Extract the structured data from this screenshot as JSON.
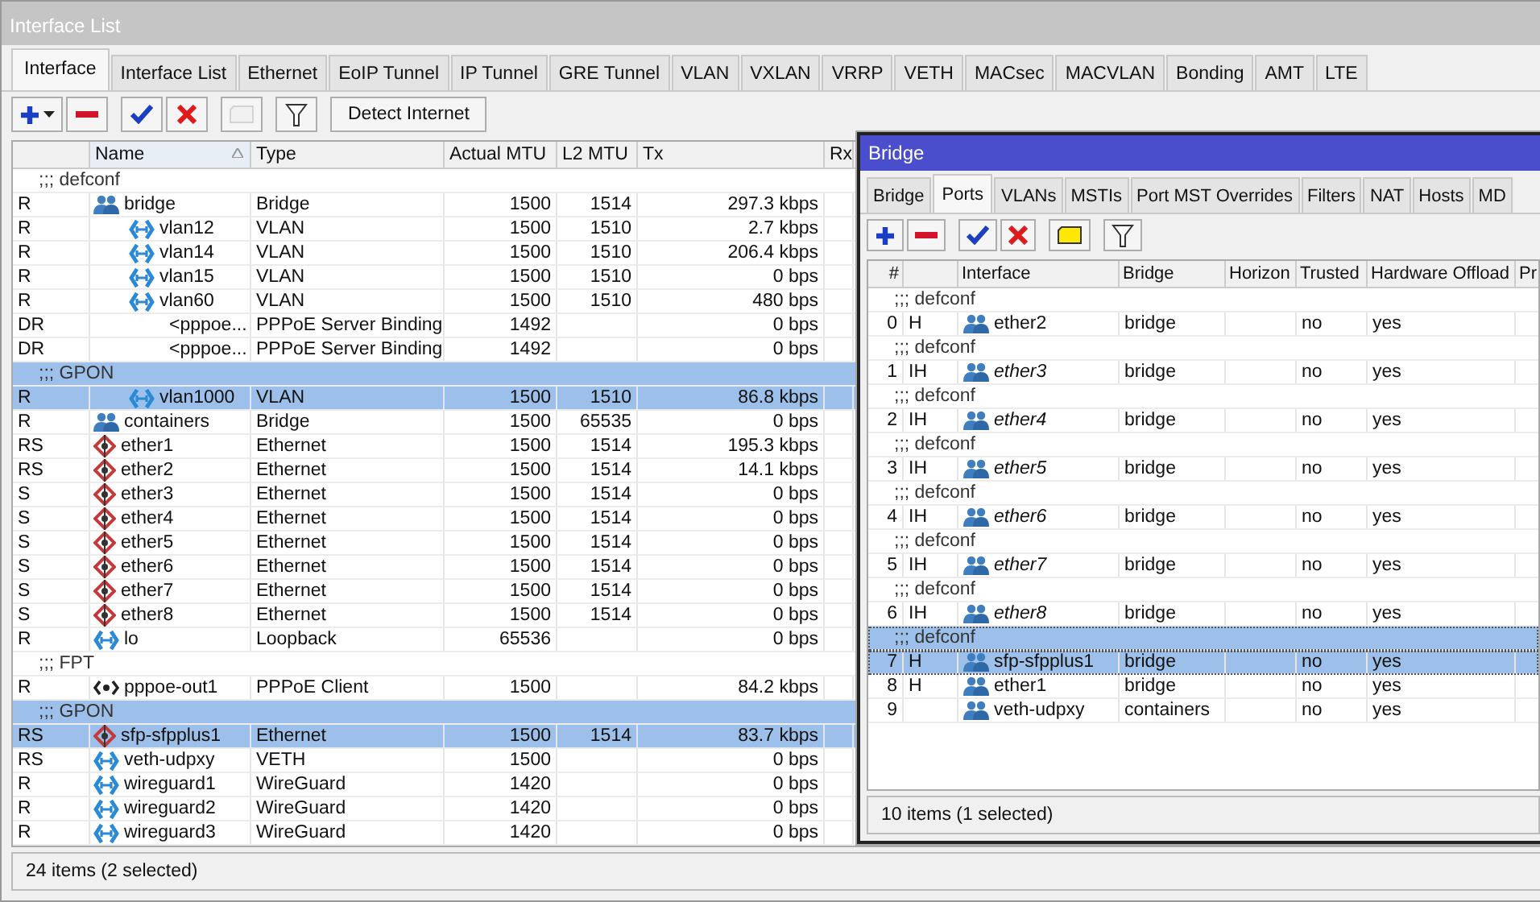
{
  "interface_window": {
    "title": "Interface List",
    "tabs": [
      {
        "label": "Interface",
        "selected": true
      },
      {
        "label": "Interface List",
        "selected": false
      },
      {
        "label": "Ethernet",
        "selected": false
      },
      {
        "label": "EoIP Tunnel",
        "selected": false
      },
      {
        "label": "IP Tunnel",
        "selected": false
      },
      {
        "label": "GRE Tunnel",
        "selected": false
      },
      {
        "label": "VLAN",
        "selected": false
      },
      {
        "label": "VXLAN",
        "selected": false
      },
      {
        "label": "VRRP",
        "selected": false
      },
      {
        "label": "VETH",
        "selected": false
      },
      {
        "label": "MACsec",
        "selected": false
      },
      {
        "label": "MACVLAN",
        "selected": false
      },
      {
        "label": "Bonding",
        "selected": false
      },
      {
        "label": "AMT",
        "selected": false
      },
      {
        "label": "LTE",
        "selected": false
      }
    ],
    "toolbar": [
      {
        "kind": "add",
        "disabled": false
      },
      {
        "kind": "remove",
        "disabled": false
      },
      {
        "kind": "enable",
        "disabled": false
      },
      {
        "kind": "disable",
        "disabled": false
      },
      {
        "kind": "comment",
        "disabled": true
      },
      {
        "kind": "filter",
        "disabled": false
      }
    ],
    "detect_button": "Detect Internet",
    "columns": [
      {
        "label": "Name",
        "sorted": true
      },
      {
        "label": "Type",
        "sorted": false
      },
      {
        "label": "Actual MTU",
        "sorted": false
      },
      {
        "label": "L2 MTU",
        "sorted": false
      },
      {
        "label": "Tx",
        "sorted": false
      },
      {
        "label": "Rx",
        "sorted": false
      }
    ],
    "rows": [
      {
        "comment": ";;; defconf",
        "flags": "R",
        "name": "bridge",
        "kind": "bridge",
        "type": "Bridge",
        "mtu": "1500",
        "l2mtu": "1514",
        "tx": "297.3 kbps",
        "selected": false,
        "children": [
          {
            "flags": "R",
            "name": "vlan12",
            "kind": "vlan",
            "type": "VLAN",
            "mtu": "1500",
            "l2mtu": "1510",
            "tx": "2.7 kbps",
            "selected": false
          },
          {
            "flags": "R",
            "name": "vlan14",
            "kind": "vlan",
            "type": "VLAN",
            "mtu": "1500",
            "l2mtu": "1510",
            "tx": "206.4 kbps",
            "selected": false
          },
          {
            "flags": "R",
            "name": "vlan15",
            "kind": "vlan",
            "type": "VLAN",
            "mtu": "1500",
            "l2mtu": "1510",
            "tx": "0 bps",
            "selected": false
          },
          {
            "flags": "R",
            "name": "vlan60",
            "kind": "vlan",
            "type": "VLAN",
            "mtu": "1500",
            "l2mtu": "1510",
            "tx": "480 bps",
            "selected": false,
            "children": [
              {
                "flags": "DR",
                "name": "<pppoe...",
                "kind": "pppoe",
                "type": "PPPoE Server Binding",
                "mtu": "1492",
                "tx": "0 bps",
                "selected": false
              },
              {
                "flags": "DR",
                "name": "<pppoe...",
                "kind": "pppoe",
                "type": "PPPoE Server Binding",
                "mtu": "1492",
                "tx": "0 bps",
                "selected": false
              }
            ]
          },
          {
            "comment": ";;; GPON",
            "flags": "R",
            "name": "vlan1000",
            "kind": "vlan",
            "type": "VLAN",
            "mtu": "1500",
            "l2mtu": "1510",
            "tx": "86.8 kbps",
            "selected": true
          }
        ]
      },
      {
        "flags": "R",
        "name": "containers",
        "kind": "bridge",
        "type": "Bridge",
        "mtu": "1500",
        "l2mtu": "65535",
        "tx": "0 bps",
        "selected": false
      },
      {
        "flags": "RS",
        "name": "ether1",
        "kind": "ether",
        "type": "Ethernet",
        "mtu": "1500",
        "l2mtu": "1514",
        "tx": "195.3 kbps",
        "selected": false
      },
      {
        "flags": "RS",
        "name": "ether2",
        "kind": "ether",
        "type": "Ethernet",
        "mtu": "1500",
        "l2mtu": "1514",
        "tx": "14.1 kbps",
        "selected": false
      },
      {
        "flags": "S",
        "name": "ether3",
        "kind": "ether",
        "type": "Ethernet",
        "mtu": "1500",
        "l2mtu": "1514",
        "tx": "0 bps",
        "selected": false
      },
      {
        "flags": "S",
        "name": "ether4",
        "kind": "ether",
        "type": "Ethernet",
        "mtu": "1500",
        "l2mtu": "1514",
        "tx": "0 bps",
        "selected": false
      },
      {
        "flags": "S",
        "name": "ether5",
        "kind": "ether",
        "type": "Ethernet",
        "mtu": "1500",
        "l2mtu": "1514",
        "tx": "0 bps",
        "selected": false
      },
      {
        "flags": "S",
        "name": "ether6",
        "kind": "ether",
        "type": "Ethernet",
        "mtu": "1500",
        "l2mtu": "1514",
        "tx": "0 bps",
        "selected": false
      },
      {
        "flags": "S",
        "name": "ether7",
        "kind": "ether",
        "type": "Ethernet",
        "mtu": "1500",
        "l2mtu": "1514",
        "tx": "0 bps",
        "selected": false
      },
      {
        "flags": "S",
        "name": "ether8",
        "kind": "ether",
        "type": "Ethernet",
        "mtu": "1500",
        "l2mtu": "1514",
        "tx": "0 bps",
        "selected": false
      },
      {
        "flags": "R",
        "name": "lo",
        "kind": "loopback",
        "type": "Loopback",
        "mtu": "65536",
        "tx": "0 bps",
        "selected": false
      },
      {
        "comment": ";;; FPT",
        "flags": "R",
        "name": "pppoe-out1",
        "kind": "pppoe",
        "type": "PPPoE Client",
        "mtu": "1500",
        "tx": "84.2 kbps",
        "selected": false
      },
      {
        "comment": ";;; GPON",
        "flags": "RS",
        "name": "sfp-sfpplus1",
        "kind": "ether",
        "type": "Ethernet",
        "mtu": "1500",
        "l2mtu": "1514",
        "tx": "83.7 kbps",
        "selected": true
      },
      {
        "flags": "RS",
        "name": "veth-udpxy",
        "kind": "veth",
        "type": "VETH",
        "mtu": "1500",
        "tx": "0 bps",
        "selected": false
      },
      {
        "flags": "R",
        "name": "wireguard1",
        "kind": "wireguard",
        "type": "WireGuard",
        "mtu": "1420",
        "tx": "0 bps",
        "selected": false
      },
      {
        "flags": "R",
        "name": "wireguard2",
        "kind": "wireguard",
        "type": "WireGuard",
        "mtu": "1420",
        "tx": "0 bps",
        "selected": false
      },
      {
        "flags": "R",
        "name": "wireguard3",
        "kind": "wireguard",
        "type": "WireGuard",
        "mtu": "1420",
        "tx": "0 bps",
        "selected": false
      }
    ],
    "status": "24 items (2 selected)"
  },
  "bridge_window": {
    "title": "Bridge",
    "tabs": [
      {
        "label": "Bridge",
        "selected": false
      },
      {
        "label": "Ports",
        "selected": true
      },
      {
        "label": "VLANs",
        "selected": false
      },
      {
        "label": "MSTIs",
        "selected": false
      },
      {
        "label": "Port MST Overrides",
        "selected": false
      },
      {
        "label": "Filters",
        "selected": false
      },
      {
        "label": "NAT",
        "selected": false
      },
      {
        "label": "Hosts",
        "selected": false
      },
      {
        "label": "MD",
        "selected": false
      }
    ],
    "toolbar": [
      {
        "kind": "add",
        "disabled": false
      },
      {
        "kind": "remove",
        "disabled": false
      },
      {
        "kind": "enable",
        "disabled": false
      },
      {
        "kind": "disable",
        "disabled": false
      },
      {
        "kind": "comment",
        "disabled": false
      },
      {
        "kind": "filter",
        "disabled": false
      }
    ],
    "columns": [
      "#",
      "Interface",
      "Bridge",
      "Horizon",
      "Trusted",
      "Hardware Offload",
      "Pr"
    ],
    "ports": [
      {
        "comment": ";;; defconf",
        "num": "0",
        "flags": "H",
        "interface": "ether2",
        "inactive": false,
        "bridge": "bridge",
        "trusted": "no",
        "hw_offload": "yes",
        "selected": false
      },
      {
        "comment": ";;; defconf",
        "num": "1",
        "flags": "IH",
        "interface": "ether3",
        "inactive": true,
        "bridge": "bridge",
        "trusted": "no",
        "hw_offload": "yes",
        "selected": false
      },
      {
        "comment": ";;; defconf",
        "num": "2",
        "flags": "IH",
        "interface": "ether4",
        "inactive": true,
        "bridge": "bridge",
        "trusted": "no",
        "hw_offload": "yes",
        "selected": false
      },
      {
        "comment": ";;; defconf",
        "num": "3",
        "flags": "IH",
        "interface": "ether5",
        "inactive": true,
        "bridge": "bridge",
        "trusted": "no",
        "hw_offload": "yes",
        "selected": false
      },
      {
        "comment": ";;; defconf",
        "num": "4",
        "flags": "IH",
        "interface": "ether6",
        "inactive": true,
        "bridge": "bridge",
        "trusted": "no",
        "hw_offload": "yes",
        "selected": false
      },
      {
        "comment": ";;; defconf",
        "num": "5",
        "flags": "IH",
        "interface": "ether7",
        "inactive": true,
        "bridge": "bridge",
        "trusted": "no",
        "hw_offload": "yes",
        "selected": false
      },
      {
        "comment": ";;; defconf",
        "num": "6",
        "flags": "IH",
        "interface": "ether8",
        "inactive": true,
        "bridge": "bridge",
        "trusted": "no",
        "hw_offload": "yes",
        "selected": false
      },
      {
        "comment": ";;; defconf",
        "num": "7",
        "flags": "H",
        "interface": "sfp-sfpplus1",
        "inactive": false,
        "bridge": "bridge",
        "trusted": "no",
        "hw_offload": "yes",
        "selected": true
      },
      {
        "num": "8",
        "flags": "H",
        "interface": "ether1",
        "inactive": false,
        "bridge": "bridge",
        "trusted": "no",
        "hw_offload": "yes",
        "selected": false
      },
      {
        "num": "9",
        "interface": "veth-udpxy",
        "inactive": false,
        "bridge": "containers",
        "trusted": "no",
        "hw_offload": "yes",
        "selected": false
      }
    ],
    "status": "10 items (1 selected)"
  }
}
